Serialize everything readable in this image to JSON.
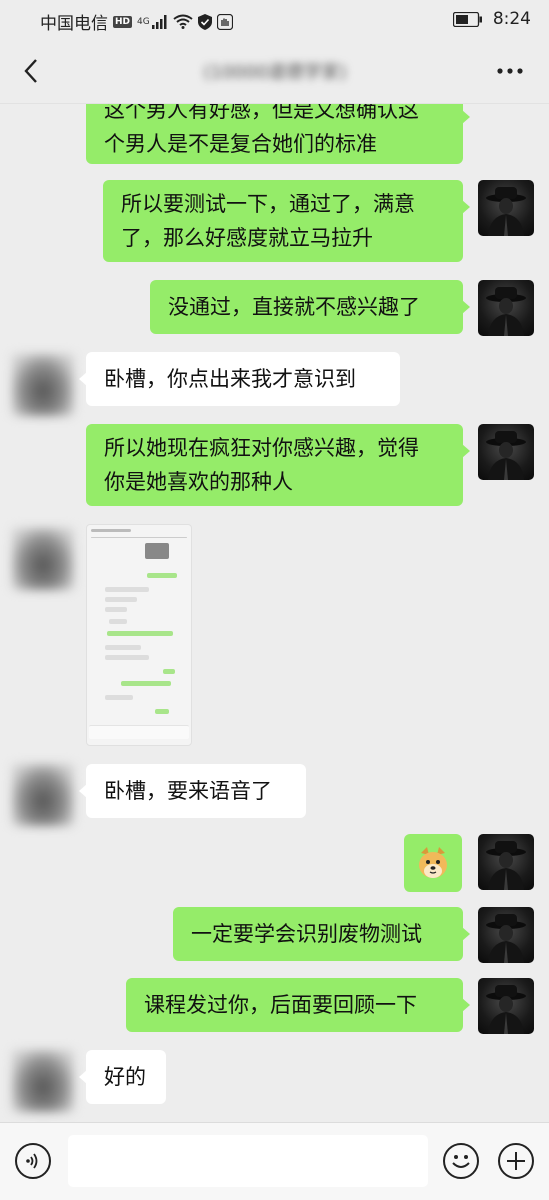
{
  "status_bar": {
    "carrier": "中国电信",
    "hd": "HD",
    "network": "4G",
    "time": "8:24",
    "icons": [
      "signal-icon",
      "wifi-icon",
      "shield-icon",
      "hand-icon",
      "battery-icon"
    ]
  },
  "header": {
    "title": "(10000道德学家)",
    "back_icon": "chevron-left-icon",
    "more_icon": "more-dots-icon"
  },
  "messages": [
    {
      "side": "right",
      "lines": [
        "这个男人有好感，但是又想确认这",
        "个男人是不是复合她们的标准"
      ]
    },
    {
      "side": "right",
      "lines": [
        "所以要测试一下，通过了，满意",
        "了，那么好感度就立马拉升"
      ]
    },
    {
      "side": "right",
      "lines": [
        "没通过，直接就不感兴趣了"
      ]
    },
    {
      "side": "left",
      "lines": [
        "卧槽，你点出来我才意识到"
      ]
    },
    {
      "side": "right",
      "lines": [
        "所以她现在疯狂对你感兴趣，觉得",
        "你是她喜欢的那种人"
      ]
    },
    {
      "side": "left",
      "type": "image",
      "lines": []
    },
    {
      "side": "left",
      "lines": [
        "卧槽，要来语音了"
      ]
    },
    {
      "side": "right",
      "type": "sticker",
      "lines": []
    },
    {
      "side": "right",
      "lines": [
        "一定要学会识别废物测试"
      ]
    },
    {
      "side": "right",
      "lines": [
        "课程发过你，后面要回顾一下"
      ]
    },
    {
      "side": "left",
      "lines": [
        "好的"
      ]
    }
  ],
  "input_bar": {
    "placeholder": "",
    "voice_icon": "voice-icon",
    "emoji_icon": "emoji-icon",
    "plus_icon": "plus-icon"
  },
  "colors": {
    "background": "#ededed",
    "bubble_self": "#95ec69",
    "bubble_other": "#ffffff"
  }
}
